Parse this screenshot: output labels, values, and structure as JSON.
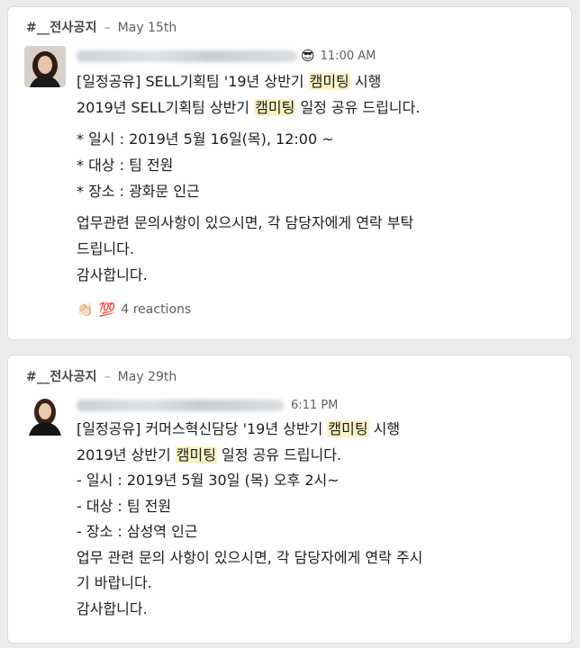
{
  "messages": [
    {
      "channel": "#__전사공지",
      "date": "May 15th",
      "status_emoji": "😎",
      "time": "11:00 AM",
      "line1_pre": "[일정공유] SELL기획팀 '19년 상반기 ",
      "line1_hl": "캠미팅",
      "line1_post": " 시행",
      "line2_pre": "2019년 SELL기획팀 상반기 ",
      "line2_hl": "캠미팅",
      "line2_post": " 일정 공유 드립니다.",
      "detail1": "* 일시 : 2019년 5월 16일(목), 12:00 ~",
      "detail2": "* 대상 : 팀 전원",
      "detail3": "* 장소 : 광화문 인근",
      "closing1": "업무관련 문의사항이 있으시면, 각 담당자에게 연락 부탁",
      "closing2": "드립니다.",
      "closing3": "감사합니다.",
      "reaction_emoji1": "👏🏻",
      "reaction_emoji2": "💯",
      "reactions_label": "4 reactions"
    },
    {
      "channel": "#__전사공지",
      "date": "May 29th",
      "time": "6:11 PM",
      "line1_pre": "[일정공유] 커머스혁신담당 '19년 상반기 ",
      "line1_hl": "캠미팅",
      "line1_post": " 시행",
      "line2_pre": "2019년 상반기 ",
      "line2_hl": "캠미팅",
      "line2_post": " 일정 공유 드립니다.",
      "detail1": "- 일시 : 2019년 5월 30일 (목) 오후 2시~",
      "detail2": "- 대상 : 팀 전원",
      "detail3": "- 장소 : 삼성역 인근",
      "closing1": "업무 관련 문의 사항이 있으시면, 각 담당자에게 연락 주시",
      "closing2": "기 바랍니다.",
      "closing3": "감사합니다."
    }
  ],
  "colors": {
    "highlight": "#fdf2c5",
    "card_bg": "#ffffff",
    "page_bg": "#ececec",
    "meta_text": "#616061"
  }
}
